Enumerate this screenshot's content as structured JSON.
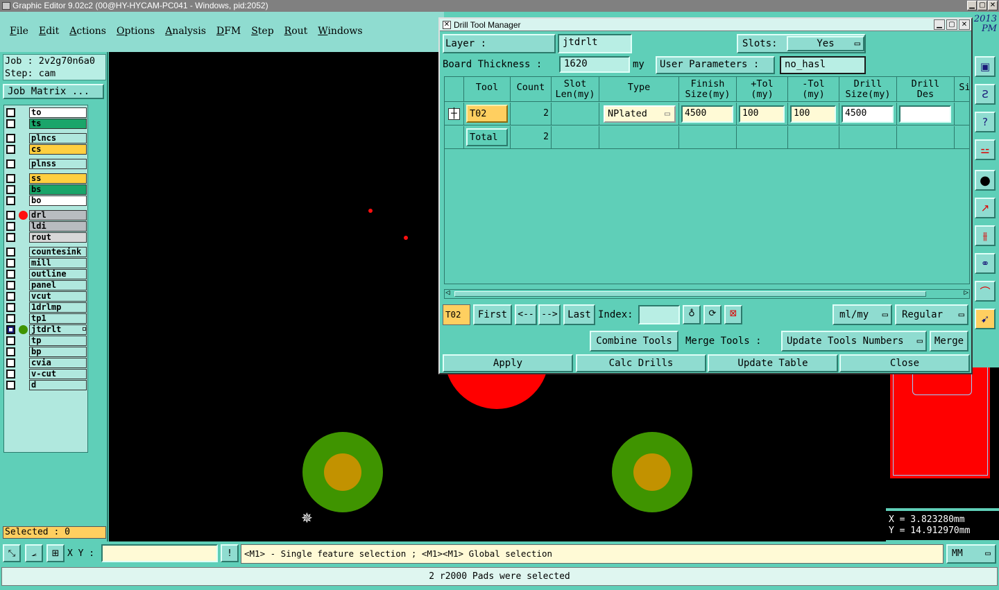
{
  "window": {
    "title": "Graphic Editor 9.02c2 (00@HY-HYCAM-PC041 - Windows, pid:2052)",
    "controls": [
      "▁",
      "▢",
      "✕"
    ]
  },
  "menu": [
    "File",
    "Edit",
    "Actions",
    "Options",
    "Analysis",
    "DFM",
    "Step",
    "Rout",
    "Windows"
  ],
  "job": {
    "job_label": "Job : 2v2g70n6a0",
    "step_label": "Step: cam",
    "matrix_button": "Job Matrix ..."
  },
  "layers": [
    {
      "name": "to",
      "color": "#ffffff",
      "active": false,
      "dot": ""
    },
    {
      "name": "ts",
      "color": "#1aa56a",
      "active": false,
      "dot": ""
    },
    {
      "name": "plncs",
      "color": "#b0e8de",
      "active": false,
      "dot": ""
    },
    {
      "name": "cs",
      "color": "#ffcf40",
      "active": false,
      "dot": ""
    },
    {
      "name": "plnss",
      "color": "#b0e8de",
      "active": false,
      "dot": ""
    },
    {
      "name": "ss",
      "color": "#ffcf40",
      "active": false,
      "dot": ""
    },
    {
      "name": "bs",
      "color": "#1aa56a",
      "active": false,
      "dot": ""
    },
    {
      "name": "bo",
      "color": "#ffffff",
      "active": false,
      "dot": ""
    },
    {
      "name": "drl",
      "color": "#b8bcc0",
      "active": false,
      "dot": "#ff1010"
    },
    {
      "name": "ldi",
      "color": "#b8bcc0",
      "active": false,
      "dot": ""
    },
    {
      "name": "rout",
      "color": "#d8d8d8",
      "active": false,
      "dot": ""
    },
    {
      "name": "countesink",
      "color": "#b0e8de",
      "active": false,
      "dot": ""
    },
    {
      "name": "mill",
      "color": "#b0e8de",
      "active": false,
      "dot": ""
    },
    {
      "name": "outline",
      "color": "#b0e8de",
      "active": false,
      "dot": ""
    },
    {
      "name": "panel",
      "color": "#b0e8de",
      "active": false,
      "dot": ""
    },
    {
      "name": "vcut",
      "color": "#b0e8de",
      "active": false,
      "dot": ""
    },
    {
      "name": "1drlmp",
      "color": "#b0e8de",
      "active": false,
      "dot": ""
    },
    {
      "name": "tp1",
      "color": "#b0e8de",
      "active": false,
      "dot": ""
    },
    {
      "name": "jtdrlt",
      "color": "#b0e8de",
      "active": true,
      "dot": "#3f9400"
    },
    {
      "name": "tp",
      "color": "#b0e8de",
      "active": false,
      "dot": ""
    },
    {
      "name": "bp",
      "color": "#b0e8de",
      "active": false,
      "dot": ""
    },
    {
      "name": "cvia",
      "color": "#b0e8de",
      "active": false,
      "dot": ""
    },
    {
      "name": "v-cut",
      "color": "#b0e8de",
      "active": false,
      "dot": ""
    },
    {
      "name": "d",
      "color": "#b0e8de",
      "active": false,
      "dot": ""
    }
  ],
  "selected_text": "Selected : 0",
  "right_strip": {
    "date_line1": "2013",
    "date_line2": "PM",
    "icons": [
      "layout-icon",
      "s-shape-icon",
      "help-icon",
      "connect-icon",
      "circle-icon",
      "move-icon",
      "feature-icon",
      "shapes-icon",
      "arc-icon",
      "pointer-icon"
    ]
  },
  "coords": {
    "x": "X = 3.823280mm",
    "y": "Y = 14.912970mm"
  },
  "bottom": {
    "xy_label": "X Y :",
    "xy_value": "",
    "hint": "<M1> - Single feature selection ; <M1><M1> Global selection",
    "units": "MM",
    "status": "2 r2000 Pads were selected"
  },
  "dialog": {
    "title": "Drill Tool Manager",
    "layer_label": "Layer :",
    "layer_value": "jtdrlt",
    "slots_label": "Slots:",
    "slots_value": "Yes",
    "thickness_label": "Board Thickness :",
    "thickness_value": "1620",
    "thickness_unit": "my",
    "user_params_label": "User Parameters :",
    "user_params_value": "no_hasl",
    "columns": [
      {
        "l1": "Tool",
        "l2": ""
      },
      {
        "l1": "Count",
        "l2": ""
      },
      {
        "l1": "Slot",
        "l2": "Len(my)"
      },
      {
        "l1": "Type",
        "l2": ""
      },
      {
        "l1": "Finish",
        "l2": "Size(my)"
      },
      {
        "l1": "+Tol",
        "l2": "(my)"
      },
      {
        "l1": "-Tol",
        "l2": "(my)"
      },
      {
        "l1": "Drill",
        "l2": "Size(my)"
      },
      {
        "l1": "Drill",
        "l2": "Des"
      },
      {
        "l1": "Si",
        "l2": ""
      }
    ],
    "rows": [
      {
        "tool": "T02",
        "count": "2",
        "slot_len": "",
        "type": "NPlated",
        "finish": "4500",
        "ptol": "100",
        "mtol": "100",
        "drill": "4500",
        "des": ""
      }
    ],
    "total": {
      "label": "Total",
      "count": "2"
    },
    "nav": {
      "current": "T02",
      "first": "First",
      "prev": "<--",
      "next": "-->",
      "last": "Last",
      "index_label": "Index:",
      "index_value": "",
      "units": "ml/my",
      "mode": "Regular"
    },
    "combine": "Combine Tools",
    "merge_label": "Merge Tools :",
    "merge_option": "Update Tools Numbers",
    "merge_btn": "Merge",
    "apply": "Apply",
    "calc": "Calc Drills",
    "update": "Update Table",
    "close": "Close"
  }
}
